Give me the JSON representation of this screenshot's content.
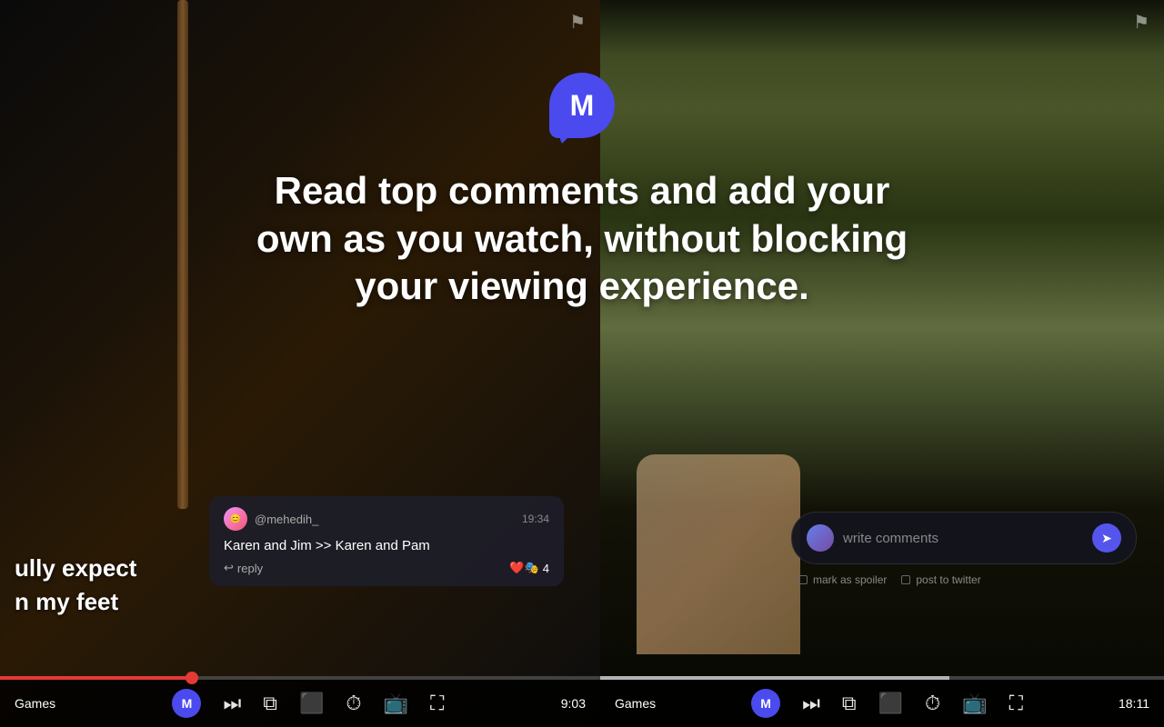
{
  "logo": {
    "letter": "M"
  },
  "heading": {
    "text": "Read top comments and add your own as you watch, without blocking your viewing experience."
  },
  "left_panel": {
    "show_name": "Games",
    "subtitle_lines": [
      "ully expect",
      "n my feet"
    ],
    "time": "9:03",
    "progress_percent": 32,
    "comment": {
      "username": "@mehedih_",
      "time": "19:34",
      "text": "Karen and Jim >> Karen and Pam",
      "reply_label": "reply",
      "reactions": "❤️🎭",
      "count": "4"
    },
    "icons": {
      "m_label": "M",
      "play_next": "⏭",
      "playlist": "⧉",
      "captions": "⬜",
      "speed": "⚡",
      "cast": "📡",
      "fullscreen": "⛶"
    }
  },
  "right_panel": {
    "show_name": "Games",
    "time": "18:11",
    "progress_percent": 62,
    "write_comment": {
      "placeholder": "write comments",
      "options": [
        {
          "label": "mark as spoiler"
        },
        {
          "label": "post to twitter"
        }
      ]
    },
    "icons": {
      "m_label": "M",
      "play_next": "⏭",
      "playlist": "⧉",
      "captions": "⬜",
      "speed": "⚡",
      "cast": "📡",
      "fullscreen": "⛶"
    }
  }
}
